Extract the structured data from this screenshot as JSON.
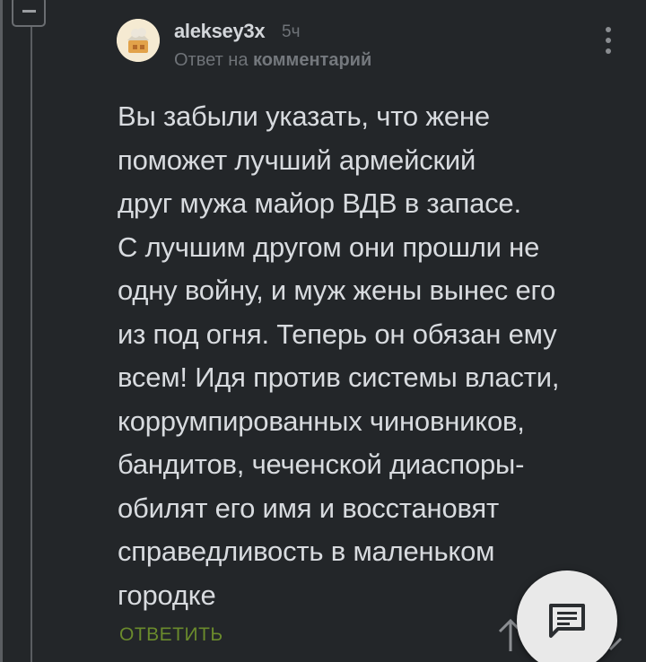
{
  "comment": {
    "author": "aleksey3x",
    "time": "5ч",
    "reply_prefix": "Ответ на",
    "reply_target": "комментарий",
    "text_lines": [
      "Вы забыли указать, что жене",
      "поможет лучший армейский",
      "друг мужа майор ВДВ в запасе.",
      "С лучшим другом они прошли не",
      "одну войну, и муж жены вынес его",
      "из под огня. Теперь он обязан ему",
      "всем! Идя против системы власти,",
      "коррумпированных чиновников,",
      "бандитов, чеченской диаспоры-",
      "обилят его имя и восстановят",
      "справедливость в маленьком",
      "городке"
    ],
    "reply_label": "ОТВЕТИТЬ"
  },
  "icons": {
    "collapse": "minus-icon",
    "more": "vertical-dots-icon",
    "scroll_up": "arrow-up-icon",
    "fab": "comment-icon"
  },
  "colors": {
    "background": "#232629",
    "text": "#d8dbdf",
    "muted": "#6f7378",
    "accent": "#6a8a2c",
    "fab": "#e9e9e9"
  }
}
